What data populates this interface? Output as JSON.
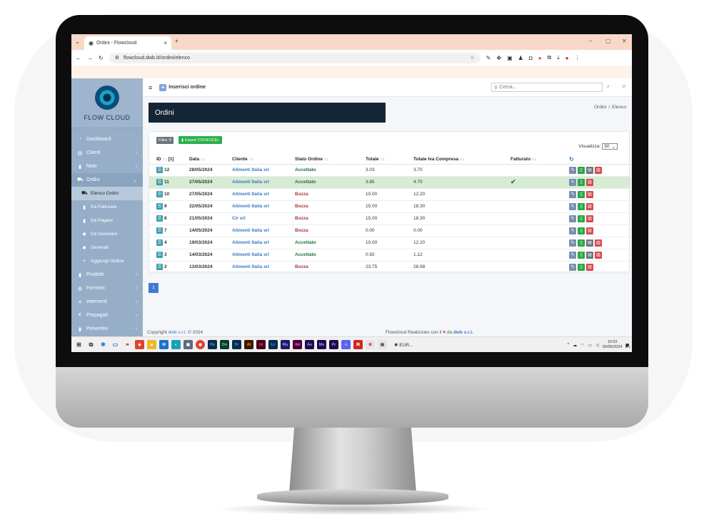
{
  "browser": {
    "tab_title": "Ordini - Flowcloud",
    "url": "flowcloud.dwb.it//ordini/elenco"
  },
  "app": {
    "brand": "FLOW CLOUD",
    "insert_label": "Inserisci ordine",
    "search_placeholder": "Cerca...",
    "page_title": "Ordini",
    "breadcrumb": [
      "Ordini",
      "/",
      "Elenco"
    ]
  },
  "sidebar": {
    "items": [
      {
        "label": "Dashboard",
        "icon": "dashboard-icon",
        "chev": ""
      },
      {
        "label": "Clienti",
        "icon": "id-card-icon",
        "chev": "‹"
      },
      {
        "label": "Note",
        "icon": "file-icon",
        "chev": "‹"
      },
      {
        "label": "Ordini",
        "icon": "cart-icon",
        "chev": "⌄"
      },
      {
        "label": "Elenco Ordini",
        "icon": "cart-icon"
      },
      {
        "label": "Da Fatturare",
        "icon": "file-icon"
      },
      {
        "label": "Da Pagare",
        "icon": "file-icon"
      },
      {
        "label": "Da Generare",
        "icon": "gear-icon"
      },
      {
        "label": "Generati",
        "icon": "gear-icon"
      },
      {
        "label": "Aggiungi Ordine",
        "icon": "plus-icon"
      },
      {
        "label": "Prodotti",
        "icon": "file-icon",
        "chev": "‹"
      },
      {
        "label": "Fornitori",
        "icon": "globe-icon",
        "chev": "‹"
      },
      {
        "label": "Interventi",
        "icon": "tools-icon",
        "chev": "‹"
      },
      {
        "label": "Prepagati",
        "icon": "euro-icon",
        "chev": "‹"
      },
      {
        "label": "Preventivi",
        "icon": "file-icon",
        "chev": "‹"
      }
    ]
  },
  "toolbar": {
    "filter_label": "Filtra",
    "export_label": "Export CSV/EXCEL",
    "visualizza_label": "Visualizza:",
    "visualizza_value": "50"
  },
  "table": {
    "headers": [
      "ID",
      "Data",
      "Cliente",
      "Stato Ordine",
      "Totale",
      "Totale Iva Compresa",
      "Fatturato"
    ],
    "id_suffix": "[1]",
    "rows": [
      {
        "id": "12",
        "date": "28/05/2024",
        "client": "Alimenti Italia srl",
        "status": "Accettato",
        "total": "3.03",
        "total_iva": "3.70",
        "invoiced": false,
        "pdf": true
      },
      {
        "id": "11",
        "date": "27/05/2024",
        "client": "Alimenti Italia srl",
        "status": "Accettato",
        "total": "3.85",
        "total_iva": "4.70",
        "invoiced": true,
        "pdf": false
      },
      {
        "id": "10",
        "date": "27/05/2024",
        "client": "Alimenti Italia srl",
        "status": "Bozza",
        "total": "10.00",
        "total_iva": "12.20",
        "invoiced": false,
        "pdf": false
      },
      {
        "id": "9",
        "date": "22/05/2024",
        "client": "Alimenti Italia srl",
        "status": "Bozza",
        "total": "15.00",
        "total_iva": "18.30",
        "invoiced": false,
        "pdf": false
      },
      {
        "id": "8",
        "date": "21/05/2024",
        "client": "Cir srl",
        "status": "Bozza",
        "total": "15.00",
        "total_iva": "18.30",
        "invoiced": false,
        "pdf": false
      },
      {
        "id": "7",
        "date": "14/05/2024",
        "client": "Alimenti Italia srl",
        "status": "Bozza",
        "total": "0.00",
        "total_iva": "0.00",
        "invoiced": false,
        "pdf": false
      },
      {
        "id": "4",
        "date": "19/03/2024",
        "client": "Alimenti Italia srl",
        "status": "Accettato",
        "total": "10.00",
        "total_iva": "12.20",
        "invoiced": false,
        "pdf": true
      },
      {
        "id": "3",
        "date": "14/03/2024",
        "client": "Alimenti Italia srl",
        "status": "Accettato",
        "total": "0.92",
        "total_iva": "1.12",
        "invoiced": false,
        "pdf": true
      },
      {
        "id": "2",
        "date": "13/03/2024",
        "client": "Alimenti Italia srl",
        "status": "Bozza",
        "total": "23.75",
        "total_iva": "28.98",
        "invoiced": false,
        "pdf": false
      }
    ]
  },
  "pagination": {
    "current": "1"
  },
  "footer": {
    "copyright_prefix": "Copyright",
    "copyright_link": "dwb s.r.l.",
    "copyright_suffix": "© 2024",
    "made_prefix": "Flowcloud Realizzato con il",
    "made_mid": "da",
    "made_link": "dwb s.r.l."
  },
  "taskbar": {
    "apps": [
      "Ps",
      "Dn",
      "Fr",
      "Ai",
      "Id",
      "Lr",
      "Ru",
      "Xd",
      "Ae",
      "Me",
      "Pr"
    ],
    "weather_label": "EUR...",
    "time": "10:53",
    "date": "05/06/2024",
    "badge": "5"
  },
  "colors": {
    "sidebar": "#96aec8",
    "header": "#142536",
    "accent": "#3b78c3",
    "highlight_row": "#d7ecd3",
    "accepted": "#216f3c",
    "draft": "#a33a3a"
  }
}
